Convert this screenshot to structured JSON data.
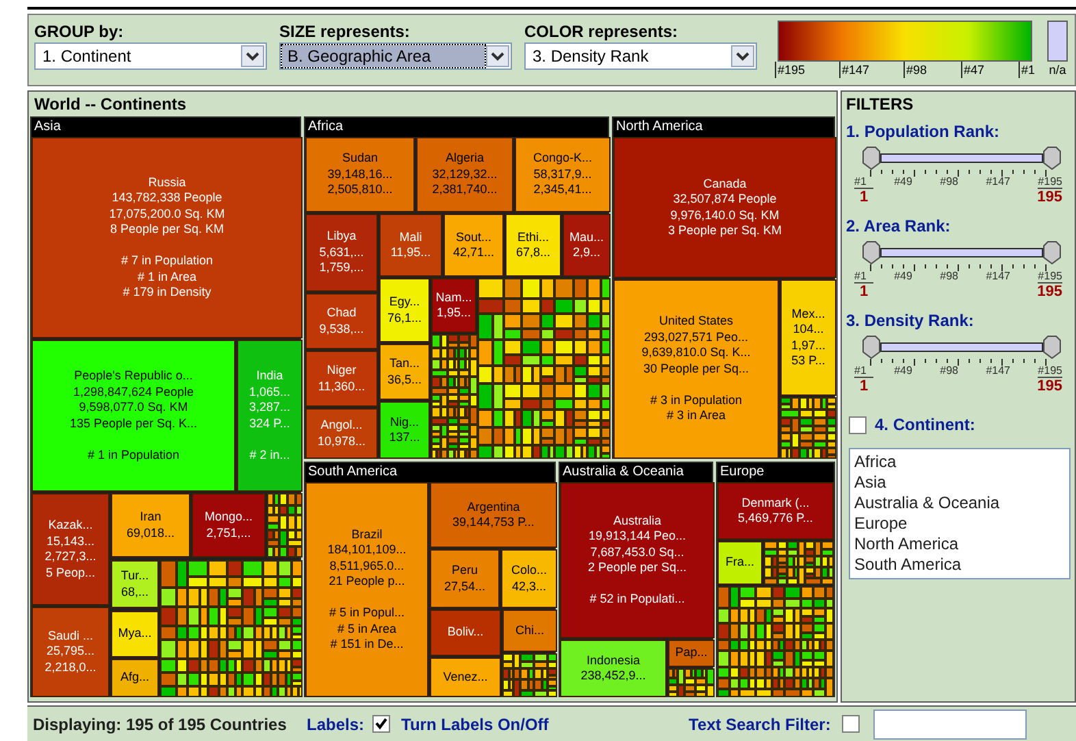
{
  "controls": [
    {
      "label": "GROUP by:",
      "value": "1. Continent",
      "focused": false
    },
    {
      "label": "SIZE represents:",
      "value": "B. Geographic Area",
      "focused": true
    },
    {
      "label": "COLOR represents:",
      "value": "3. Density Rank",
      "focused": false
    }
  ],
  "legend": {
    "ticks": [
      "#195",
      "#147",
      "#98",
      "#47",
      "#1"
    ],
    "na": "n/a"
  },
  "treemap": {
    "title": "World -- Continents",
    "groups": [
      {
        "name": "Asia",
        "countries": [
          {
            "lines": [
              "Russia",
              "143,782,338 People",
              "17,075,200.0 Sq. KM",
              "8 People per Sq. KM"
            ],
            "ranks": [
              "# 7 in Population",
              "# 1 in Area",
              "# 179 in Density"
            ],
            "color": "#c03a08"
          },
          {
            "lines": [
              "People's Republic o...",
              "1,298,847,624 People",
              "9,598,077.0 Sq. KM",
              "135 People per Sq. K..."
            ],
            "ranks": [
              "# 1 in Population"
            ],
            "color": "#22ff00"
          },
          {
            "lines": [
              "India",
              "1,065...",
              "3,287...",
              "324 P..."
            ],
            "ranks": [
              "# 2 in..."
            ],
            "color": "#10c010"
          },
          {
            "lines": [
              "Kazak...",
              "15,143...",
              "2,727,3...",
              "5 Peop..."
            ],
            "color": "#b02a08"
          },
          {
            "lines": [
              "Saudi ...",
              "25,795...",
              "2,218,0..."
            ],
            "color": "#c04008"
          },
          {
            "lines": [
              "Iran",
              "69,018..."
            ],
            "color": "#f8a800"
          },
          {
            "lines": [
              "Mongo...",
              "2,751,..."
            ],
            "color": "#a00808"
          },
          {
            "lines": [
              "Tur...",
              "68,..."
            ],
            "color": "#b0f020"
          },
          {
            "lines": [
              "Mya..."
            ],
            "color": "#f8e000"
          },
          {
            "lines": [
              "Afg..."
            ],
            "color": "#f0b000"
          }
        ]
      },
      {
        "name": "Africa",
        "countries": [
          {
            "lines": [
              "Sudan",
              "39,148,16...",
              "2,505,810..."
            ],
            "color": "#e07000"
          },
          {
            "lines": [
              "Algeria",
              "32,129,32...",
              "2,381,740..."
            ],
            "color": "#d86400"
          },
          {
            "lines": [
              "Congo-K...",
              "58,317,9...",
              "2,345,41..."
            ],
            "color": "#f09000"
          },
          {
            "lines": [
              "Libya",
              "5,631,...",
              "1,759,..."
            ],
            "color": "#b02808"
          },
          {
            "lines": [
              "Mali",
              "11,95..."
            ],
            "color": "#c04008"
          },
          {
            "lines": [
              "Sout...",
              "42,71..."
            ],
            "color": "#f8a800"
          },
          {
            "lines": [
              "Ethi...",
              "67,8..."
            ],
            "color": "#f8e000"
          },
          {
            "lines": [
              "Mau...",
              "2,9..."
            ],
            "color": "#a81808"
          },
          {
            "lines": [
              "Chad",
              "9,538,..."
            ],
            "color": "#c03808"
          },
          {
            "lines": [
              "Niger",
              "11,360..."
            ],
            "color": "#c03808"
          },
          {
            "lines": [
              "Angol...",
              "10,978..."
            ],
            "color": "#c04008"
          },
          {
            "lines": [
              "Egy...",
              "76,1..."
            ],
            "color": "#f0f000"
          },
          {
            "lines": [
              "Tan...",
              "36,5..."
            ],
            "color": "#f8b000"
          },
          {
            "lines": [
              "Nig...",
              "137..."
            ],
            "color": "#28e800"
          },
          {
            "lines": [
              "Nam...",
              "1,95..."
            ],
            "color": "#a00808"
          }
        ]
      },
      {
        "name": "North America",
        "countries": [
          {
            "lines": [
              "Canada",
              "32,507,874 People",
              "9,976,140.0 Sq. KM",
              "3 People per Sq. KM"
            ],
            "color": "#a81800"
          },
          {
            "lines": [
              "United States",
              "293,027,571 Peo...",
              "9,639,810.0 Sq. K...",
              "30 People per Sq..."
            ],
            "ranks": [
              "# 3 in Population",
              "# 3 in Area"
            ],
            "color": "#f8a000"
          },
          {
            "lines": [
              "Mex...",
              "104...",
              "1,97...",
              "53 P..."
            ],
            "color": "#f8d000"
          }
        ]
      },
      {
        "name": "South America",
        "countries": [
          {
            "lines": [
              "Brazil",
              "184,101,109...",
              "8,511,965.0...",
              "21 People p..."
            ],
            "ranks": [
              "# 5 in Popul...",
              "# 5 in Area",
              "# 151 in De..."
            ],
            "color": "#f09000"
          },
          {
            "lines": [
              "Argentina",
              "39,144,753 P..."
            ],
            "color": "#d86400"
          },
          {
            "lines": [
              "Peru",
              "27,54..."
            ],
            "color": "#e88000"
          },
          {
            "lines": [
              "Colo...",
              "42,3..."
            ],
            "color": "#f8b800"
          },
          {
            "lines": [
              "Boliv..."
            ],
            "color": "#b83000"
          },
          {
            "lines": [
              "Chi..."
            ],
            "color": "#e07800"
          },
          {
            "lines": [
              "Venez..."
            ],
            "color": "#f8a800"
          }
        ]
      },
      {
        "name": "Australia & Oceania",
        "countries": [
          {
            "lines": [
              "Australia",
              "19,913,144 Peo...",
              "7,687,453.0 Sq...",
              "2 People per Sq..."
            ],
            "ranks": [
              "# 52 in Populati..."
            ],
            "color": "#a00808"
          },
          {
            "lines": [
              "Indonesia",
              "238,452,9..."
            ],
            "color": "#70f020"
          },
          {
            "lines": [
              "Pap..."
            ],
            "color": "#d06000"
          }
        ]
      },
      {
        "name": "Europe",
        "countries": [
          {
            "lines": [
              "Denmark (...",
              "5,469,776 P..."
            ],
            "color": "#a00808"
          },
          {
            "lines": [
              "Fra..."
            ],
            "color": "#c0f000"
          }
        ]
      }
    ]
  },
  "filters": {
    "title": "FILTERS",
    "sliders": [
      {
        "label": "1. Population Rank:",
        "ticks": [
          "#1",
          "#49",
          "#98",
          "#147",
          "#195"
        ],
        "min": "1",
        "max": "195",
        "thumbs": [
          {
            "level": 0
          },
          {
            "level": 1
          }
        ]
      },
      {
        "label": "2. Area Rank:",
        "ticks": [
          "#1",
          "#49",
          "#98",
          "#147",
          "#195"
        ],
        "min": "1",
        "max": "195",
        "thumbs": [
          {
            "level": 0
          },
          {
            "level": 1
          }
        ]
      },
      {
        "label": "3. Density Rank:",
        "ticks": [
          "#1",
          "#49",
          "#98",
          "#147",
          "#195"
        ],
        "min": "1",
        "max": "195",
        "thumbs": [
          {
            "level": 0
          },
          {
            "level": 1
          }
        ]
      }
    ],
    "continent": {
      "label": "4. Continent:",
      "checked": false,
      "options": [
        "Africa",
        "Asia",
        "Australia & Oceania",
        "Europe",
        "North America",
        "South America"
      ]
    }
  },
  "status_bar": {
    "displaying": "Displaying: 195 of 195 Countries",
    "labels_label": "Labels:",
    "labels_checked": true,
    "labels_toggle": "Turn Labels On/Off",
    "search_label": "Text Search Filter:",
    "search_checked": false
  }
}
